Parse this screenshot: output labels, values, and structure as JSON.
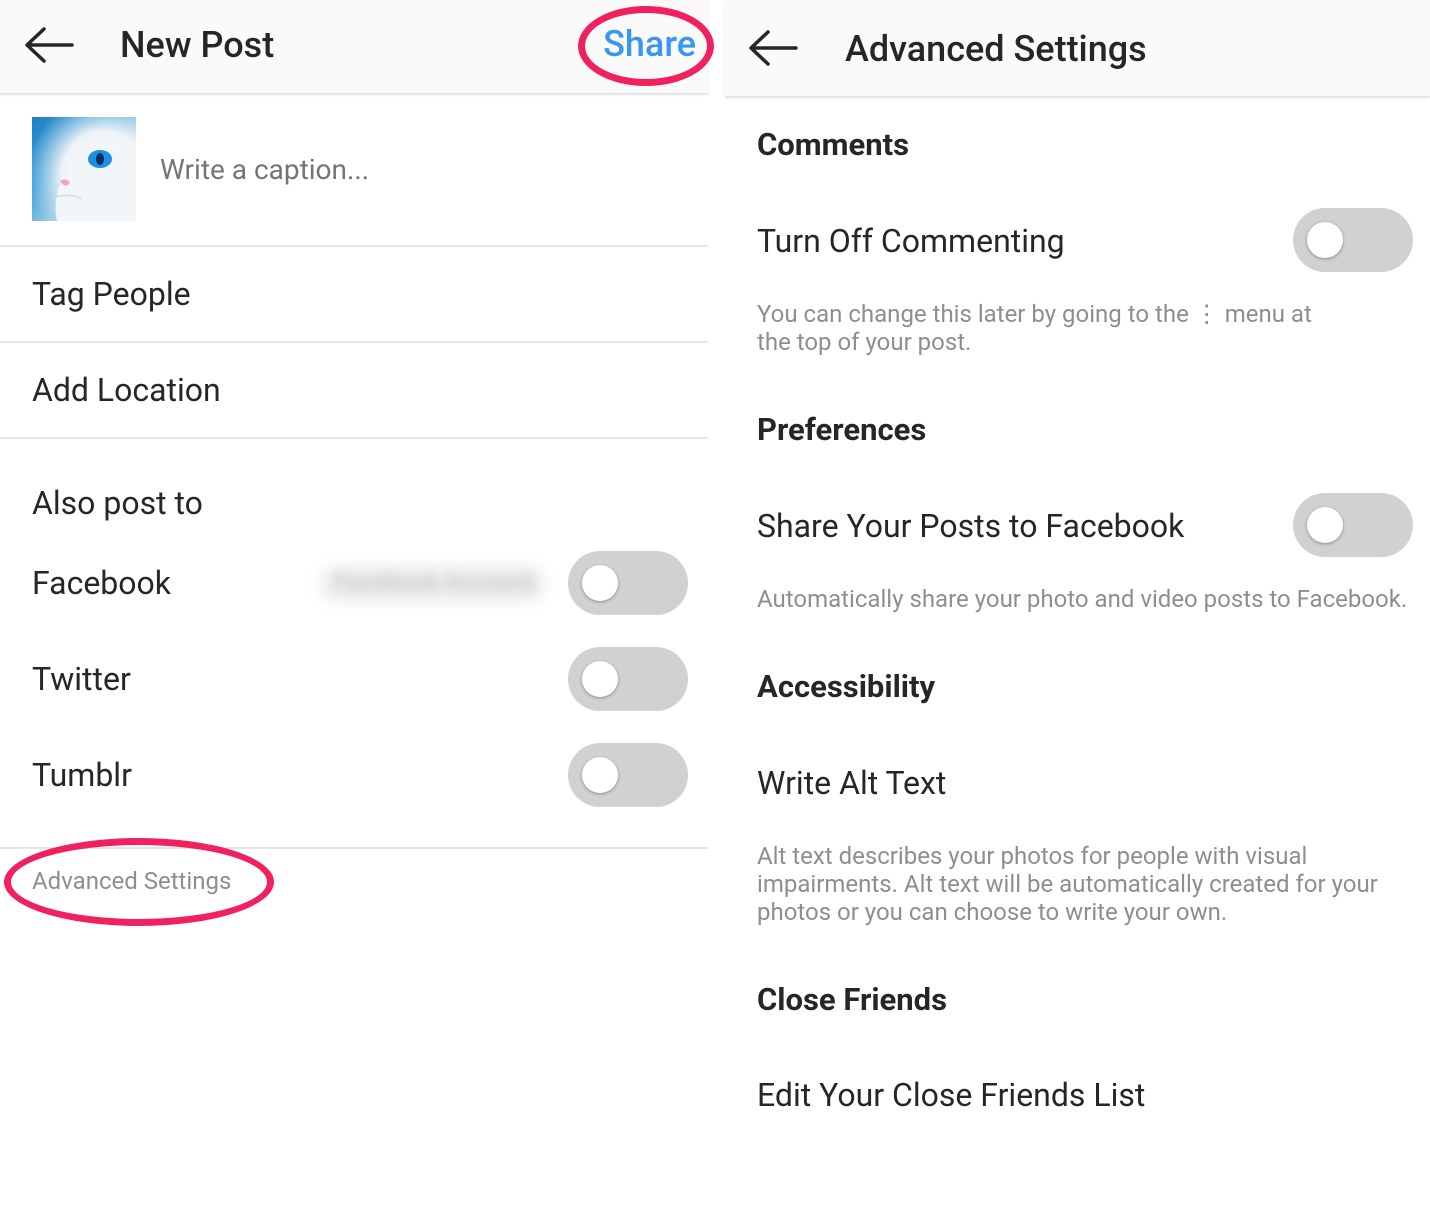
{
  "new_post": {
    "title": "New Post",
    "share_label": "Share",
    "caption_placeholder": "Write a caption...",
    "tag_people_label": "Tag People",
    "add_location_label": "Add Location",
    "also_post_to_label": "Also post to",
    "facebook_label": "Facebook",
    "facebook_account": "Facebook Account",
    "twitter_label": "Twitter",
    "tumblr_label": "Tumblr",
    "advanced_settings_label": "Advanced Settings",
    "toggles": {
      "facebook": false,
      "twitter": false,
      "tumblr": false
    }
  },
  "advanced_settings": {
    "title": "Advanced Settings",
    "comments": {
      "section_title": "Comments",
      "turn_off_commenting_label": "Turn Off Commenting",
      "turn_off_commenting_on": false,
      "desc_line1": "You can change this later by going to the ⋮ menu at",
      "desc_line2": "the top of your post."
    },
    "preferences": {
      "section_title": "Preferences",
      "share_to_facebook_label": "Share Your Posts to Facebook",
      "share_to_facebook_on": false,
      "desc": "Automatically share your photo and video posts to Facebook."
    },
    "accessibility": {
      "section_title": "Accessibility",
      "write_alt_text_label": "Write Alt Text",
      "desc_line1": "Alt text describes your photos for people with visual",
      "desc_line2": "impairments. Alt text will be automatically created for your",
      "desc_line3": "photos or you can choose to write your own."
    },
    "close_friends": {
      "section_title": "Close Friends",
      "edit_list_label": "Edit Your Close Friends List"
    }
  },
  "colors": {
    "accent_blue": "#3897f0",
    "highlight_red": "#f0215d",
    "toggle_off": "#d1d1d1",
    "secondary_text": "#8e8e8e"
  },
  "icons": {
    "back": "arrow-left-icon",
    "menu": "more-vertical-icon"
  }
}
